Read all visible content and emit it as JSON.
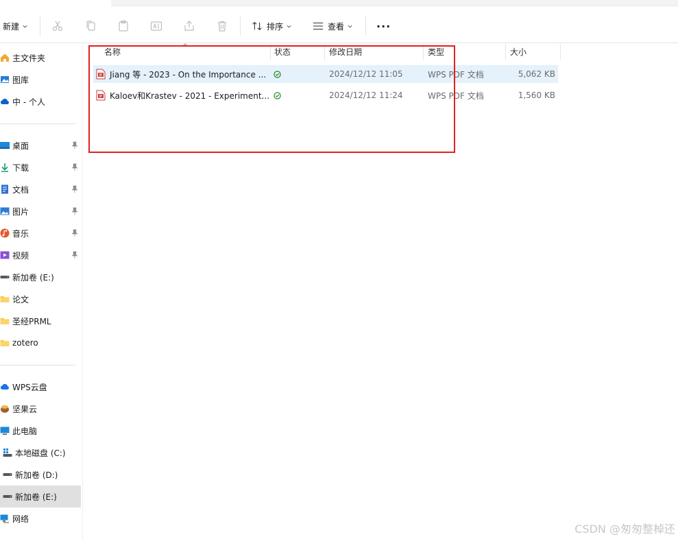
{
  "toolbar": {
    "new_label": "新建",
    "sort_label": "排序",
    "view_label": "查看",
    "more_label": "···"
  },
  "sidebar": {
    "top": [
      {
        "label": "主文件夹",
        "icon": "home-icon"
      },
      {
        "label": "图库",
        "icon": "gallery-icon"
      },
      {
        "label": "中 - 个人",
        "icon": "onedrive-cloud-icon"
      }
    ],
    "pinned": [
      {
        "label": "桌面",
        "icon": "desktop-icon"
      },
      {
        "label": "下载",
        "icon": "download-icon"
      },
      {
        "label": "文档",
        "icon": "documents-icon"
      },
      {
        "label": "图片",
        "icon": "pictures-icon"
      },
      {
        "label": "音乐",
        "icon": "music-icon"
      },
      {
        "label": "视频",
        "icon": "videos-icon"
      },
      {
        "label": "新加卷 (E:)",
        "icon": "drive-icon"
      },
      {
        "label": "论文",
        "icon": "folder-icon"
      },
      {
        "label": "圣经PRML",
        "icon": "folder-icon"
      },
      {
        "label": "zotero",
        "icon": "folder-icon"
      }
    ],
    "locations": [
      {
        "label": "WPS云盘",
        "icon": "wps-cloud-icon"
      },
      {
        "label": "坚果云",
        "icon": "jianguoyun-icon"
      },
      {
        "label": "此电脑",
        "icon": "this-pc-icon"
      },
      {
        "label": "本地磁盘 (C:)",
        "icon": "windows-drive-icon"
      },
      {
        "label": "新加卷 (D:)",
        "icon": "drive-icon"
      },
      {
        "label": "新加卷 (E:)",
        "icon": "drive-icon",
        "selected": true
      },
      {
        "label": "网络",
        "icon": "network-icon"
      }
    ]
  },
  "columns": {
    "name": "名称",
    "status": "状态",
    "modified": "修改日期",
    "type": "类型",
    "size": "大小"
  },
  "files": [
    {
      "name": "Jiang 等 - 2023 - On the Importance ...",
      "status": "synced",
      "modified": "2024/12/12 11:05",
      "type": "WPS PDF 文档",
      "size": "5,062 KB",
      "selected": true
    },
    {
      "name": "Kaloev和Krastev - 2021 - Experiment...",
      "status": "synced",
      "modified": "2024/12/12 11:24",
      "type": "WPS PDF 文档",
      "size": "1,560 KB",
      "selected": false
    }
  ],
  "watermark": "CSDN @匆匆整棹还",
  "colors": {
    "accent": "#0067c0",
    "selection": "#e5f1fb",
    "highlight_box": "#e02020",
    "synced": "#107c10"
  }
}
